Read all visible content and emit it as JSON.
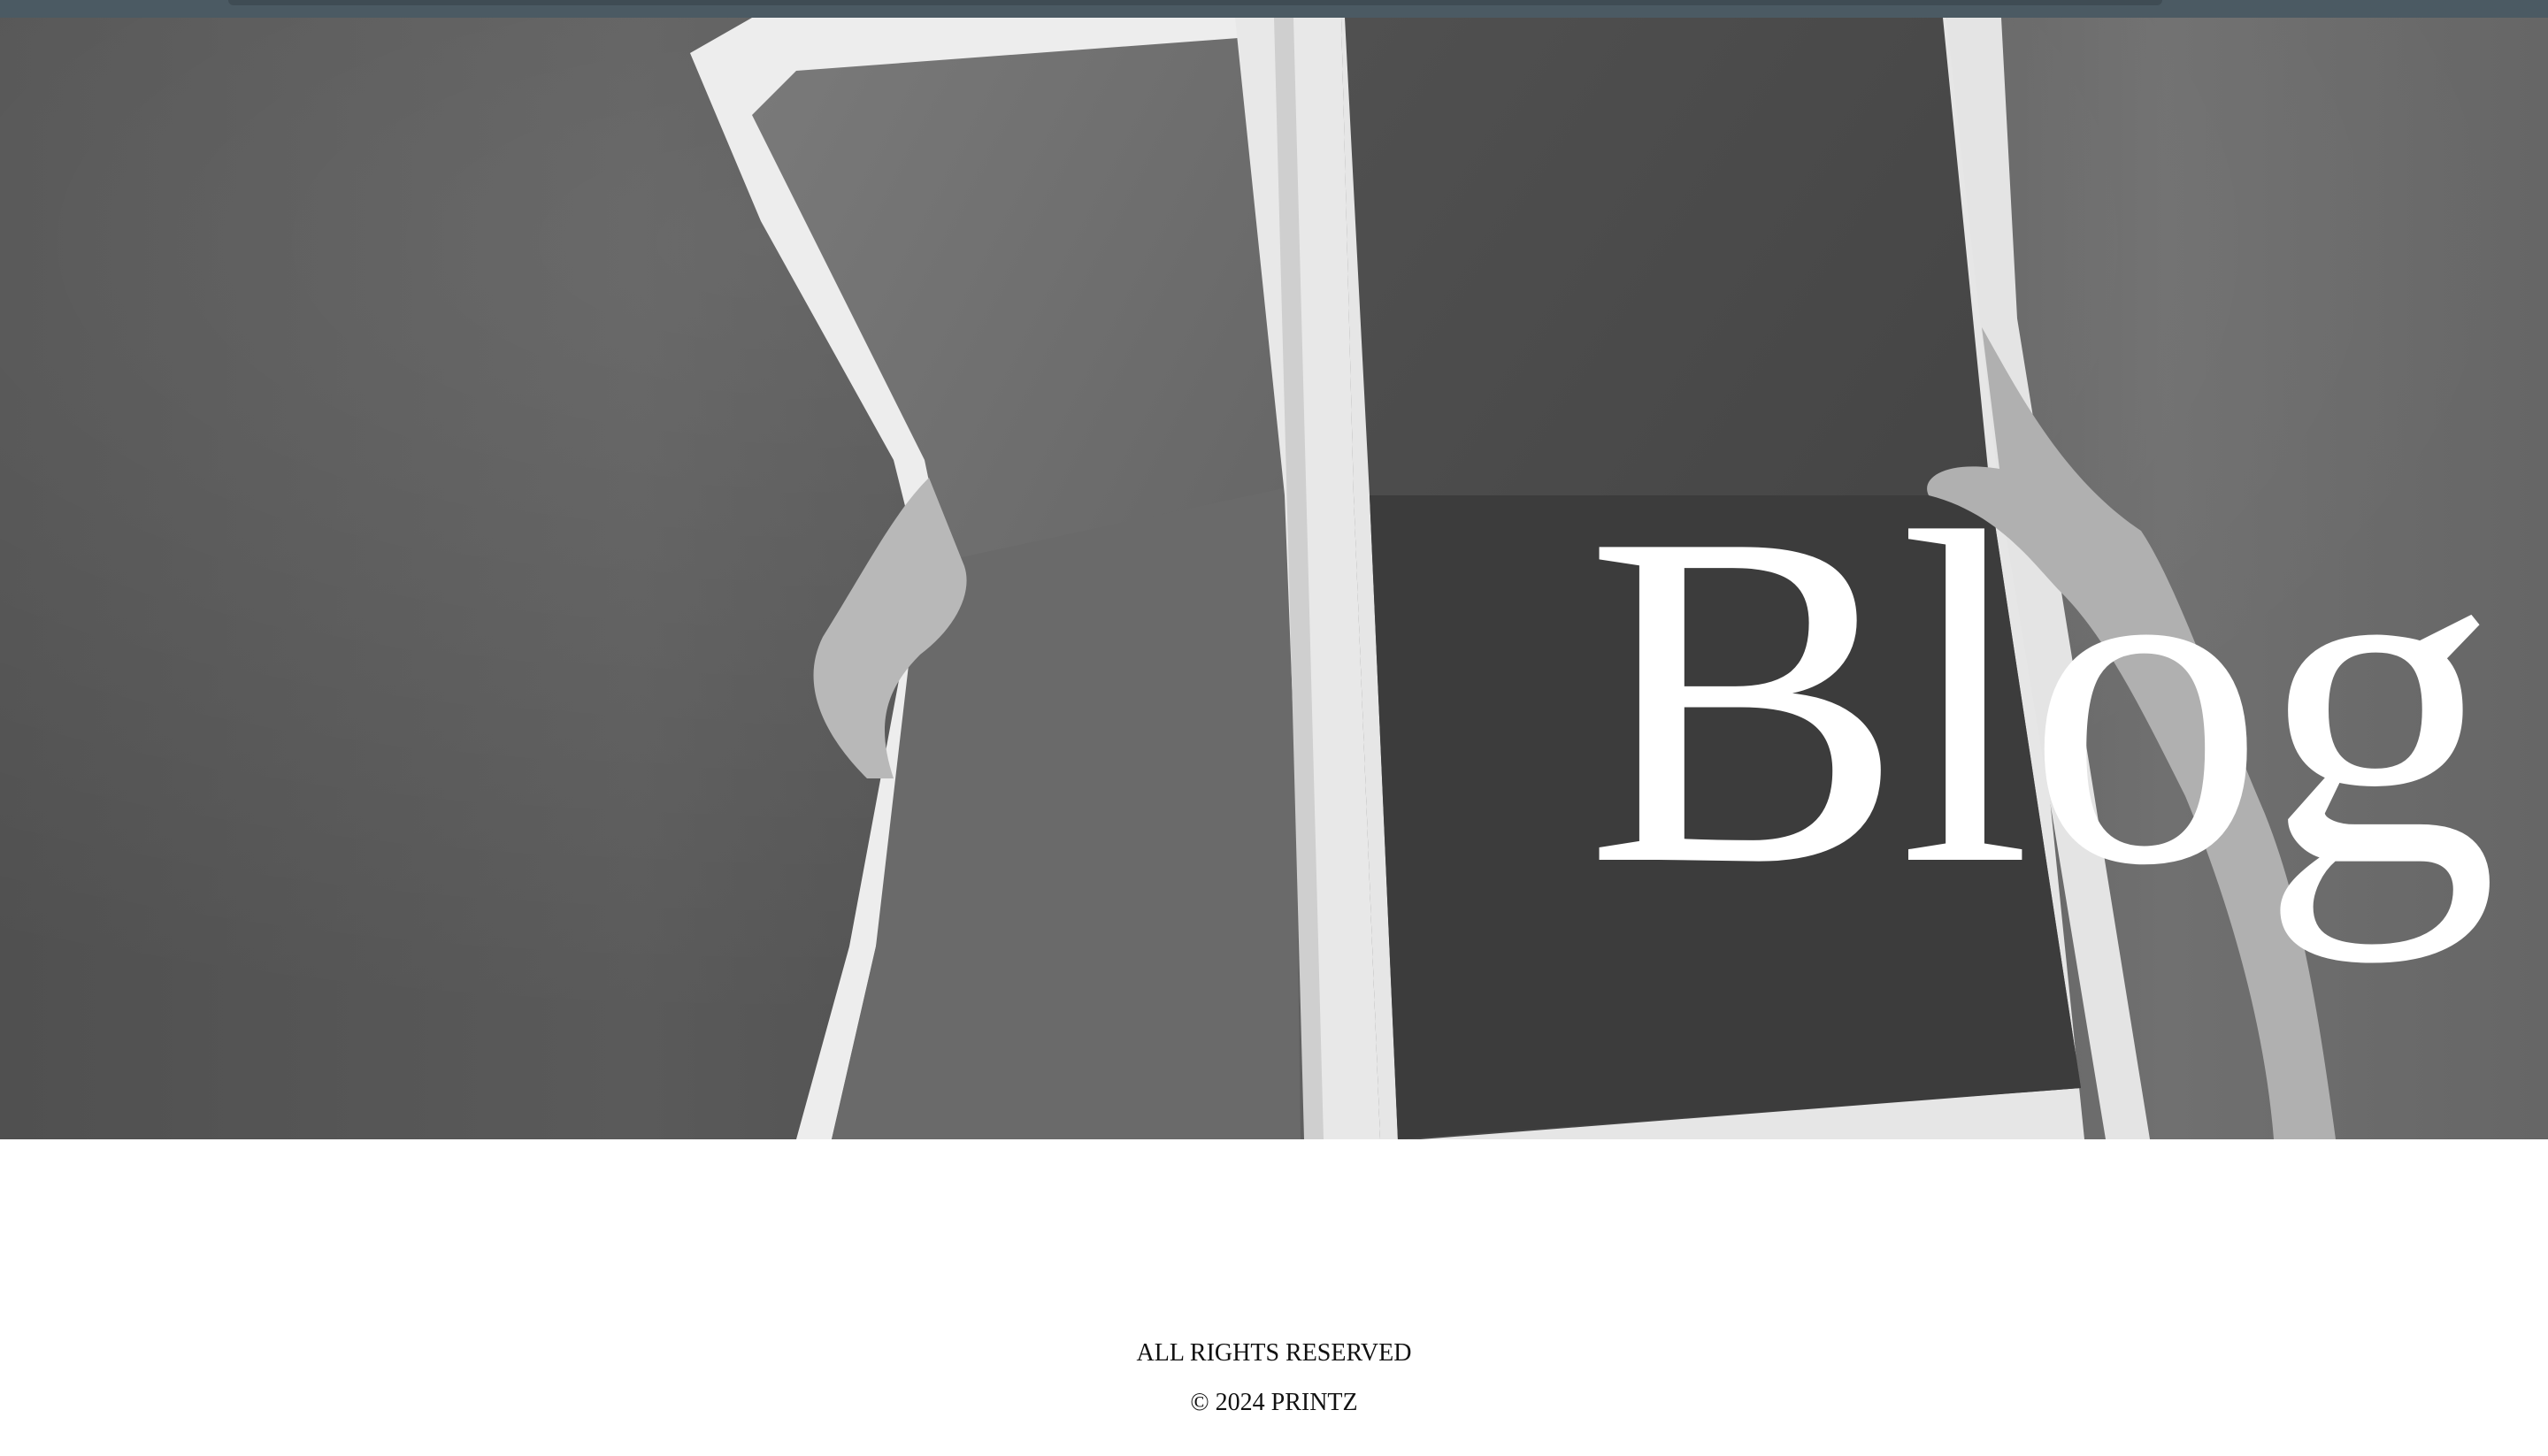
{
  "hero": {
    "title": "Blog"
  },
  "footer": {
    "rights": "ALL RIGHTS RESERVED",
    "copyright": "© 2024 PRINTZ"
  },
  "colors": {
    "topbar": "#4b5a63",
    "page_background": "#ffffff",
    "hero_title": "#ffffff",
    "footer_text": "#111111"
  }
}
